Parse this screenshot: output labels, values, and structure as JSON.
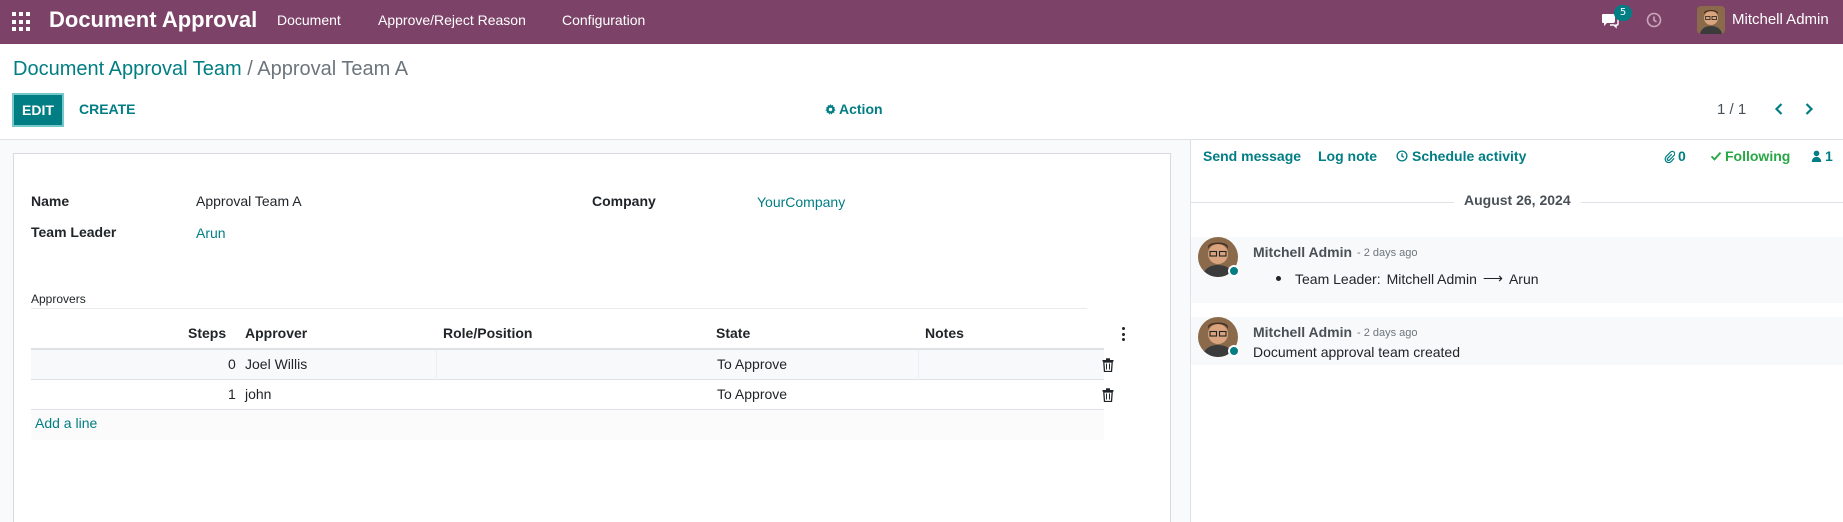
{
  "navbar": {
    "brand": "Document Approval",
    "menu": [
      {
        "label": "Document"
      },
      {
        "label": "Approve/Reject Reason"
      },
      {
        "label": "Configuration"
      }
    ],
    "chat_count": "5",
    "user": "Mitchell Admin"
  },
  "breadcrumb": {
    "parent": "Document Approval Team",
    "separator": "/",
    "current": "Approval Team A"
  },
  "toolbar": {
    "edit_label": "EDIT",
    "create_label": "CREATE",
    "action_label": "Action",
    "pager": "1 / 1"
  },
  "form": {
    "name_label": "Name",
    "name_value": "Approval Team A",
    "leader_label": "Team Leader",
    "leader_value": "Arun",
    "company_label": "Company",
    "company_value": "YourCompany",
    "approvers_label": "Approvers",
    "columns": [
      "Steps",
      "Approver",
      "Role/Position",
      "State",
      "Notes"
    ],
    "rows": [
      {
        "steps": "0",
        "approver": "Joel Willis",
        "role": "",
        "state": "To Approve",
        "notes": ""
      },
      {
        "steps": "1",
        "approver": "john",
        "role": "",
        "state": "To Approve",
        "notes": ""
      }
    ],
    "add_line": "Add a line"
  },
  "chatter": {
    "send_message": "Send message",
    "log_note": "Log note",
    "schedule_activity": "Schedule activity",
    "attachments": "0",
    "following": "Following",
    "followers": "1",
    "date": "August 26, 2024",
    "messages": [
      {
        "author": "Mitchell Admin",
        "when": "- 2 days ago",
        "tracking_field": "Team Leader:",
        "old": "Mitchell Admin",
        "arrow": "⟶",
        "new": "Arun"
      },
      {
        "author": "Mitchell Admin",
        "when": "- 2 days ago",
        "body": "Document approval team created"
      }
    ]
  },
  "colors": {
    "navbar": "#7c4268",
    "primary": "#017e84",
    "following": "#28a745"
  }
}
